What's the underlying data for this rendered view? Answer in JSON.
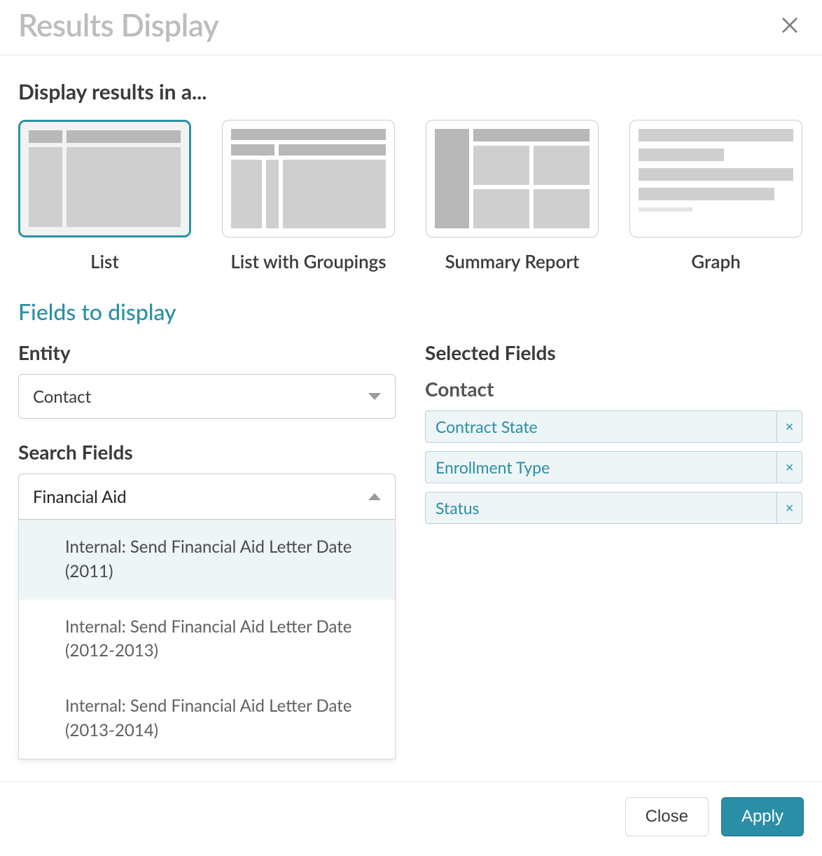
{
  "dialog": {
    "title": "Results Display",
    "display_heading": "Display results in a...",
    "options": [
      {
        "label": "List"
      },
      {
        "label": "List with Groupings"
      },
      {
        "label": "Summary Report"
      },
      {
        "label": "Graph"
      }
    ],
    "fields_section_title": "Fields to display",
    "entity_label": "Entity",
    "entity_value": "Contact",
    "search_fields_label": "Search Fields",
    "search_value": "Financial Aid",
    "search_results": [
      {
        "label": "Internal: Send Financial Aid Letter Date (2011)"
      },
      {
        "label": "Internal: Send Financial Aid Letter Date (2012-2013)"
      },
      {
        "label": "Internal: Send Financial Aid Letter Date (2013-2014)"
      }
    ],
    "selected_fields_label": "Selected Fields",
    "selected_group_label": "Contact",
    "selected_fields": [
      {
        "label": "Contract State"
      },
      {
        "label": "Enrollment Type"
      },
      {
        "label": "Status"
      }
    ]
  },
  "footer": {
    "close": "Close",
    "apply": "Apply"
  }
}
